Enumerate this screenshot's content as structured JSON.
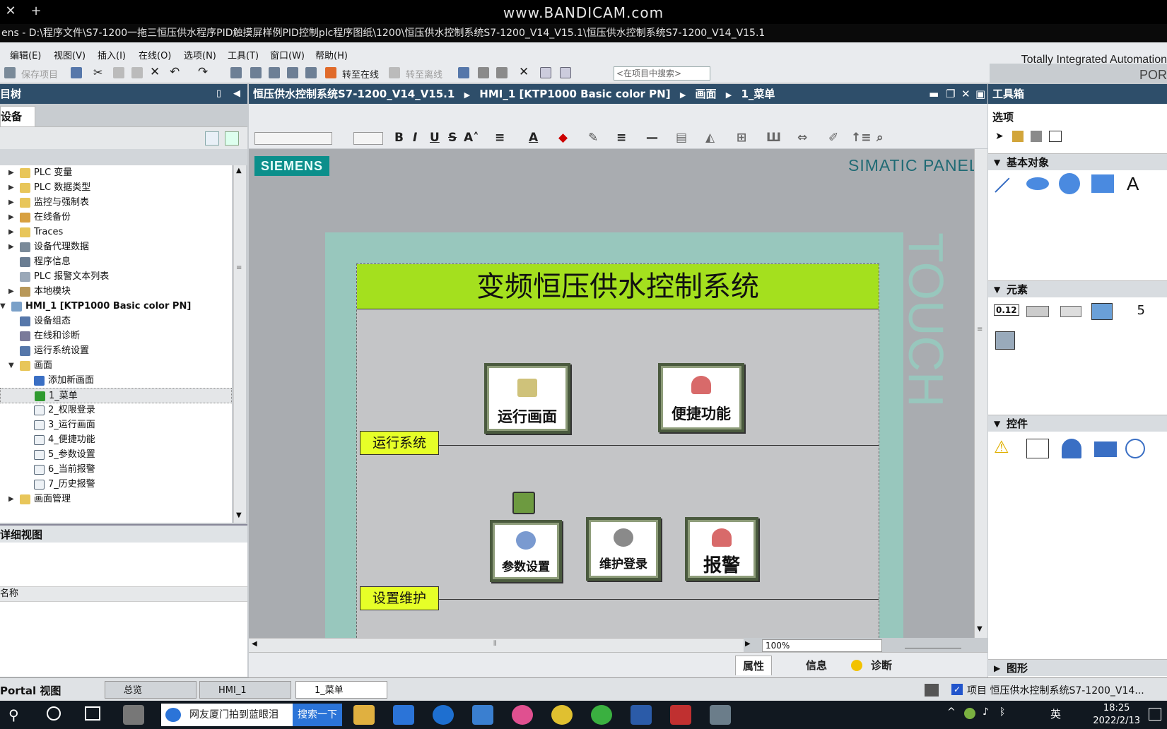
{
  "browser": {
    "new_tab": "+",
    "watermark": "www.BANDICAM.com"
  },
  "window": {
    "title": "ens  -  D:\\程序文件\\S7-1200一拖三恒压供水程序PID触摸屏样例PID控制plc程序图纸\\1200\\恒压供水控制系统S7-1200_V14_V15.1\\恒压供水控制系统S7-1200_V14_V15.1"
  },
  "menu": [
    "编辑(E)",
    "视图(V)",
    "插入(I)",
    "在线(O)",
    "选项(N)",
    "工具(T)",
    "窗口(W)",
    "帮助(H)"
  ],
  "brand": {
    "line1": "Totally Integrated Automation",
    "line2": "POR"
  },
  "toolbar": {
    "save_label": "保存项目",
    "go_online": "转至在线",
    "go_offline": "转至离线",
    "search_placeholder": "<在项目中搜索>"
  },
  "project_tree": {
    "title": "目树",
    "tab": "设备",
    "items": [
      {
        "label": "PLC 变量",
        "level": 1,
        "expand": "right",
        "icon": "folder-icon"
      },
      {
        "label": "PLC 数据类型",
        "level": 1,
        "expand": "right",
        "icon": "folder-icon"
      },
      {
        "label": "监控与强制表",
        "level": 1,
        "expand": "right",
        "icon": "folder-icon"
      },
      {
        "label": "在线备份",
        "level": 1,
        "expand": "right",
        "icon": "backup-icon"
      },
      {
        "label": "Traces",
        "level": 1,
        "expand": "right",
        "icon": "folder-icon"
      },
      {
        "label": "设备代理数据",
        "level": 1,
        "expand": "right",
        "icon": "proxy-icon"
      },
      {
        "label": "程序信息",
        "level": 1,
        "expand": "",
        "icon": "info-icon"
      },
      {
        "label": "PLC 报警文本列表",
        "level": 1,
        "expand": "",
        "icon": "list-icon"
      },
      {
        "label": "本地模块",
        "level": 1,
        "expand": "right",
        "icon": "module-icon"
      },
      {
        "label": "HMI_1 [KTP1000 Basic color PN]",
        "level": 0,
        "expand": "down",
        "icon": "hmi-icon"
      },
      {
        "label": "设备组态",
        "level": 1,
        "expand": "",
        "icon": "config-icon"
      },
      {
        "label": "在线和诊断",
        "level": 1,
        "expand": "",
        "icon": "diag-icon"
      },
      {
        "label": "运行系统设置",
        "level": 1,
        "expand": "",
        "icon": "wrench-icon"
      },
      {
        "label": "画面",
        "level": 1,
        "expand": "down",
        "icon": "folder-open-icon"
      },
      {
        "label": "添加新画面",
        "level": 2,
        "expand": "",
        "icon": "add-screen-icon"
      },
      {
        "label": "1_菜单",
        "level": 2,
        "expand": "",
        "icon": "start-screen-icon",
        "selected": true
      },
      {
        "label": "2_权限登录",
        "level": 2,
        "expand": "",
        "icon": "screen-icon"
      },
      {
        "label": "3_运行画面",
        "level": 2,
        "expand": "",
        "icon": "screen-icon"
      },
      {
        "label": "4_便捷功能",
        "level": 2,
        "expand": "",
        "icon": "screen-icon"
      },
      {
        "label": "5_参数设置",
        "level": 2,
        "expand": "",
        "icon": "screen-icon"
      },
      {
        "label": "6_当前报警",
        "level": 2,
        "expand": "",
        "icon": "screen-icon"
      },
      {
        "label": "7_历史报警",
        "level": 2,
        "expand": "",
        "icon": "screen-icon"
      },
      {
        "label": "画面管理",
        "level": 1,
        "expand": "right",
        "icon": "folder-icon"
      }
    ]
  },
  "detail_view": {
    "title": "详细视图",
    "col_name": "名称"
  },
  "editor": {
    "breadcrumb": [
      "恒压供水控制系统S7-1200_V14_V15.1",
      "HMI_1 [KTP1000 Basic color PN]",
      "画面",
      "1_菜单"
    ],
    "panel_brand": "SIEMENS",
    "panel_model": "SIMATIC PANEL",
    "panel_touch": "TOUCH",
    "zoom": "100%"
  },
  "hmi_screen": {
    "title": "变频恒压供水控制系统",
    "group1_label": "运行系统",
    "group2_label": "设置维护",
    "buttons": [
      {
        "label": "运行画面",
        "icon": "home-icon"
      },
      {
        "label": "便捷功能",
        "icon": "hand-icon"
      },
      {
        "label": "参数设置",
        "icon": "gear-icon"
      },
      {
        "label": "维护登录",
        "icon": "key-icon"
      },
      {
        "label": "报警",
        "icon": "alarm-hand-icon"
      }
    ]
  },
  "bottom_tabs": [
    "属性",
    "信息",
    "诊断"
  ],
  "toolbox": {
    "title": "工具箱",
    "options": "选项",
    "sections": [
      "基本对象",
      "元素",
      "控件",
      "图形"
    ],
    "io_field_text": "0.12",
    "clock_digit": "5",
    "basic_text_tool": "A"
  },
  "portal_bar": {
    "portal_view": "Portal 视图",
    "tabs": [
      "总览",
      "HMI_1",
      "1_菜单"
    ],
    "status": "项目 恒压供水控制系统S7-1200_V14..."
  },
  "taskbar": {
    "search_text": "网友厦门拍到蓝眼泪",
    "search_button": "搜索一下",
    "ime": "英",
    "time": "18:25",
    "date": "2022/2/13"
  }
}
